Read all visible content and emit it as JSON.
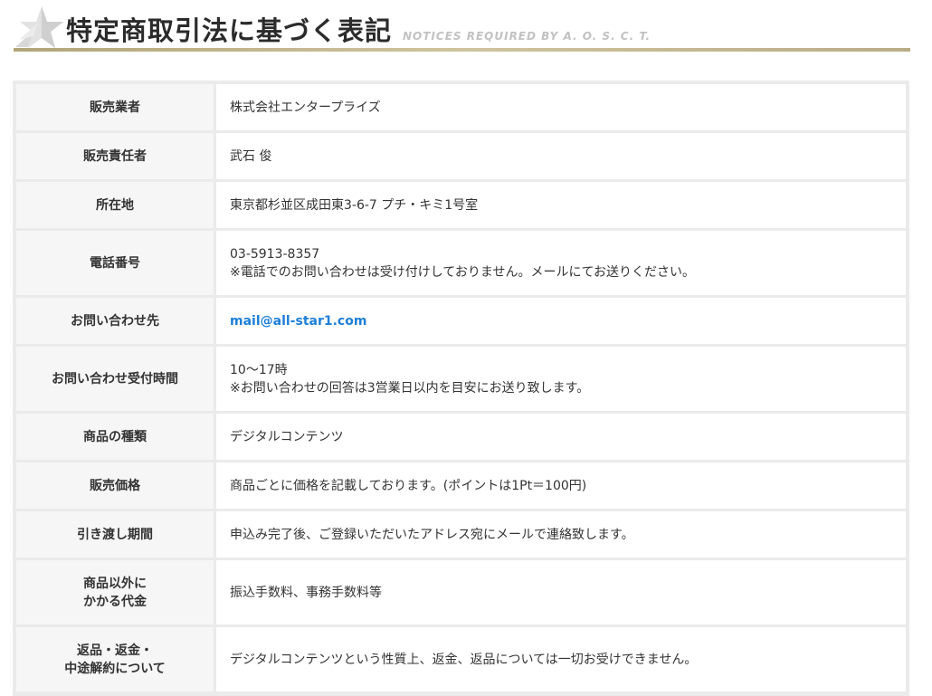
{
  "header": {
    "title": "特定商取引法に基づく表記",
    "subtitle": "NOTICES REQUIRED BY A.  O.  S.  C.  T.",
    "icon": "star-icon"
  },
  "colors": {
    "rule_gold": "#c4b88f",
    "link_blue": "#1e7fd8",
    "label_bg": "#f6f6f6",
    "border": "#ebebeb"
  },
  "rows": [
    {
      "label": "販売業者",
      "value": "株式会社エンタープライズ"
    },
    {
      "label": "販売責任者",
      "value": "武石 俊"
    },
    {
      "label": "所在地",
      "value": "東京都杉並区成田東3-6-7 プチ・キミ1号室"
    },
    {
      "label": "電話番号",
      "value": "03-5913-8357",
      "note": "※電話でのお問い合わせは受け付けしておりません。メールにてお送りください。"
    },
    {
      "label": "お問い合わせ先",
      "link": "mail@all-star1.com"
    },
    {
      "label": "お問い合わせ受付時間",
      "value": "10～17時",
      "note": "※お問い合わせの回答は3営業日以内を目安にお送り致します。"
    },
    {
      "label": "商品の種類",
      "value": "デジタルコンテンツ"
    },
    {
      "label": "販売価格",
      "value": "商品ごとに価格を記載しております。(ポイントは1Pt＝100円)"
    },
    {
      "label": "引き渡し期間",
      "value": "申込み完了後、ご登録いただいたアドレス宛にメールで連絡致します。"
    },
    {
      "label_line1": "商品以外に",
      "label_line2": "かかる代金",
      "value": "振込手数料、事務手数料等"
    },
    {
      "label_line1": "返品・返金・",
      "label_line2": "中途解約について",
      "value": "デジタルコンテンツという性質上、返金、返品については一切お受けできません。"
    }
  ]
}
